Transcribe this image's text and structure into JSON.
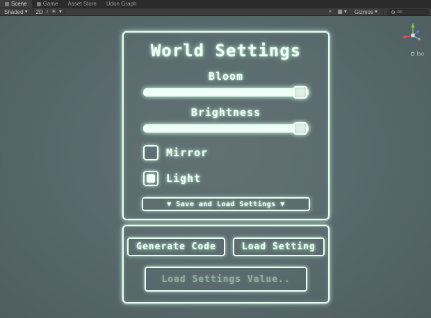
{
  "window": {
    "tabs": [
      {
        "label": "Scene",
        "active": true
      },
      {
        "label": "Game",
        "active": false
      },
      {
        "label": "Asset Store",
        "active": false
      },
      {
        "label": "Udon Graph",
        "active": false
      }
    ],
    "toolbar": {
      "shading_mode": "Shaded",
      "mode_2d": "2D",
      "gizmos_label": "Gizmos",
      "search_value": "All"
    },
    "icons": {
      "dropdown_arrow": "▾",
      "audio": "♪",
      "effects": "☀",
      "tools": "×",
      "grid": "▦"
    },
    "orientation_label": "Iso"
  },
  "world_settings": {
    "title": "World Settings",
    "sliders": [
      {
        "label": "Bloom",
        "value": 1
      },
      {
        "label": "Brightness",
        "value": 1
      }
    ],
    "checkboxes": [
      {
        "label": "Mirror",
        "checked": false
      },
      {
        "label": "Light",
        "checked": true
      }
    ],
    "save_load_button": "▼ Save and Load Settings ▼"
  },
  "save_load_panel": {
    "generate_code_button": "Generate Code",
    "load_setting_button": "Load Setting",
    "load_value_field": "Load Settings Value.."
  },
  "colors": {
    "glow": "#ecfff4",
    "scene_background": "#5a6a6d",
    "dim_text": "#94aba1",
    "axis_red": "#d9534a",
    "axis_green": "#8bc34a",
    "axis_blue": "#4a7fd9"
  }
}
